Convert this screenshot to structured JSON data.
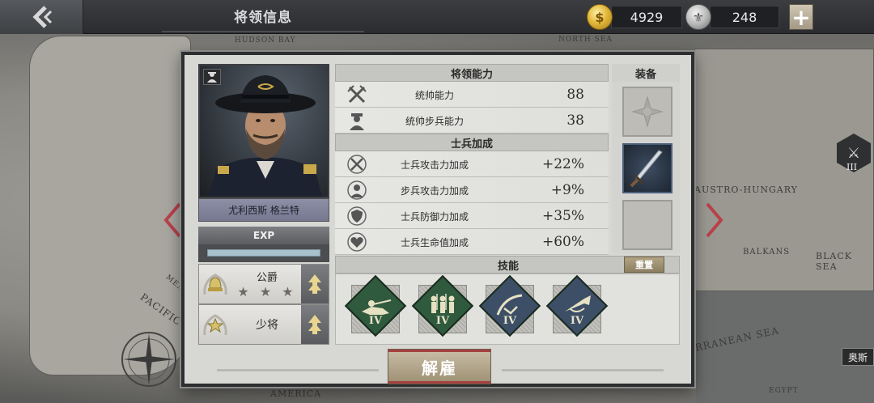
{
  "topbar": {
    "title": "将领信息",
    "gold": "4929",
    "silver": "248"
  },
  "map": {
    "labels": [
      "HUDSON BAY",
      "NORTH SEA",
      "AUSTRO-HUNGARY",
      "BALKANS",
      "BLACK SEA",
      "PACIFIC O",
      "RRANEAN SEA",
      "EGYPT",
      "AMERICA",
      "MEX"
    ],
    "marker_level": "III",
    "side_tag": "奥斯"
  },
  "general": {
    "name": "尤利西斯 格兰特",
    "exp_label": "EXP",
    "exp_fraction": 0.0,
    "ranks": [
      {
        "title": "公爵",
        "stars": "★ ★ ★"
      },
      {
        "title": "少将",
        "stars": ""
      }
    ]
  },
  "abilities": {
    "header": "将领能力",
    "rows": [
      {
        "icon": "crossed-swords-icon",
        "label": "统帅能力",
        "value": "88"
      },
      {
        "icon": "infantry-soldier-icon",
        "label": "统帅步兵能力",
        "value": "38"
      }
    ]
  },
  "bonuses": {
    "header": "士兵加成",
    "rows": [
      {
        "icon": "attack-bonus-icon",
        "label": "士兵攻击力加成",
        "value": "+22%"
      },
      {
        "icon": "infantry-attack-icon",
        "label": "步兵攻击力加成",
        "value": "+9%"
      },
      {
        "icon": "shield-bonus-icon",
        "label": "士兵防御力加成",
        "value": "+35%"
      },
      {
        "icon": "heart-bonus-icon",
        "label": "士兵生命值加成",
        "value": "+60%"
      }
    ]
  },
  "equipment": {
    "header": "装备",
    "slots": [
      "medal-slot-empty",
      "dagger-item",
      "empty-slot"
    ]
  },
  "skills": {
    "header": "技能",
    "reset_label": "重置",
    "items": [
      {
        "icon": "rifleman-prone-icon",
        "level": "IV",
        "color": "#2f5a3e"
      },
      {
        "icon": "infantry-squad-icon",
        "level": "IV",
        "color": "#2f5a3e"
      },
      {
        "icon": "cavalry-sabre-icon",
        "level": "IV",
        "color": "#3c4f66"
      },
      {
        "icon": "bugle-icon",
        "level": "IV",
        "color": "#3c4f66"
      }
    ]
  },
  "actions": {
    "dismiss_label": "解雇"
  }
}
